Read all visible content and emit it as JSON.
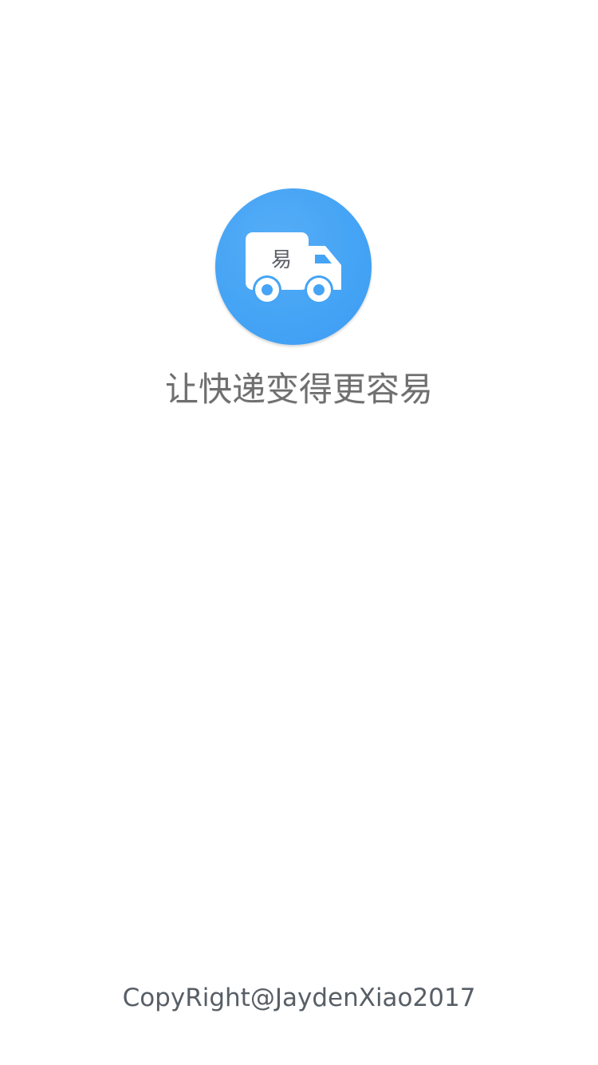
{
  "splash": {
    "logo": {
      "icon": "delivery-truck-icon",
      "char": "易",
      "circle_color": "#45a4f5"
    },
    "slogan": "让快递变得更容易",
    "copyright": "CopyRight@JaydenXiao2017"
  }
}
